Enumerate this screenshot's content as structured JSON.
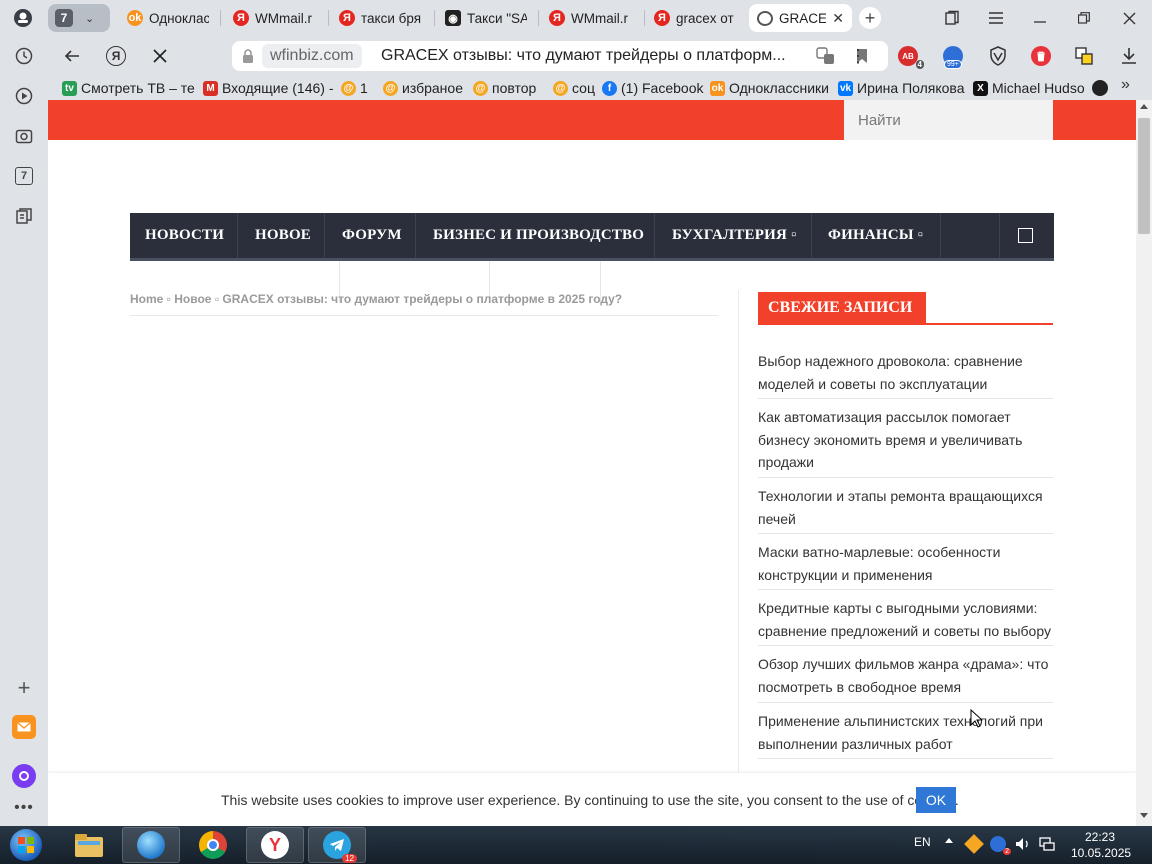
{
  "browser": {
    "tab_counter": "7",
    "tabs": [
      {
        "label": "Одноклас",
        "favicon": "odnoklassniki-icon",
        "color": "#f7931e"
      },
      {
        "label": "WMmail.r",
        "favicon": "yandex-icon",
        "color": "#e52620"
      },
      {
        "label": "такси бря",
        "favicon": "yandex-icon",
        "color": "#e52620"
      },
      {
        "label": "Такси \"SA",
        "favicon": "taxi-icon",
        "color": "#222222"
      },
      {
        "label": "WMmail.r",
        "favicon": "yandex-icon",
        "color": "#e52620"
      },
      {
        "label": "gracex от",
        "favicon": "yandex-icon",
        "color": "#e52620"
      },
      {
        "label": "GRACE",
        "favicon": "globe-icon",
        "color": "#555555",
        "active": true
      }
    ],
    "address": {
      "domain": "wfinbiz.com",
      "page_title": "GRACEX отзывы: что думают трейдеры о платформ..."
    },
    "extensions": {
      "abp_badge": "4",
      "mail_badge": "99+"
    },
    "bookmarks": [
      {
        "label": "Смотреть ТВ – те",
        "icon": "tv-icon",
        "color": "#2a9d55"
      },
      {
        "label": "Входящие (146) -",
        "icon": "gmail-icon",
        "color": "#d93025"
      },
      {
        "label": "1",
        "icon": "mailru-icon",
        "color": "#f5a623"
      },
      {
        "label": "избраное",
        "icon": "mailru-icon",
        "color": "#f5a623"
      },
      {
        "label": "повтор",
        "icon": "mailru-icon",
        "color": "#f5a623"
      },
      {
        "label": "соц",
        "icon": "mailru-icon",
        "color": "#f5a623"
      },
      {
        "label": "(1) Facebook",
        "icon": "facebook-icon",
        "color": "#1877f2"
      },
      {
        "label": "Одноклассники",
        "icon": "odnoklassniki-icon",
        "color": "#f7931e"
      },
      {
        "label": "Ирина Полякова",
        "icon": "vk-icon",
        "color": "#0077ff"
      },
      {
        "label": "Michael Hudso",
        "icon": "x-icon",
        "color": "#111111"
      }
    ]
  },
  "site": {
    "search_placeholder": "Найти",
    "nav": [
      {
        "label": "НОВОСТИ"
      },
      {
        "label": "НОВОЕ"
      },
      {
        "label": "ФОРУМ"
      },
      {
        "label": "БИЗНЕС И ПРОИЗВОДСТВО"
      },
      {
        "label": "БУХГАЛТЕРИЯ ▫"
      },
      {
        "label": "ФИНАНСЫ ▫"
      }
    ],
    "breadcrumbs": "Home ▫ Новое ▫ GRACEX отзывы: что думают трейдеры о платформе в 2025 году?",
    "widget": {
      "title": "СВЕЖИЕ ЗАПИСИ",
      "posts": [
        "Выбор надежного дровокола: сравнение моделей и советы по эксплуатации",
        "Как автоматизация рассылок помогает бизнесу экономить время и увеличивать продажи",
        "Технологии и этапы ремонта вращающихся печей",
        "Маски ватно-марлевые: особенности конструкции и применения",
        "Кредитные карты с выгодными условиями: сравнение предложений и советы по выбору",
        "Обзор лучших фильмов жанра «драма»: что посмотреть в свободное время",
        "Применение альпинистских технологий при выполнении различных работ"
      ]
    },
    "cookie": {
      "text": "This website uses cookies to improve user experience. By continuing to use the site, you consent to the use of cookies.",
      "ok_label": "OK"
    },
    "accent_color": "#f2412a",
    "nav_color": "#2a2f3b"
  },
  "taskbar": {
    "language": "EN",
    "time": "22:23",
    "date": "10.05.2025",
    "telegram_badge": "12",
    "tray_badge": "2"
  }
}
